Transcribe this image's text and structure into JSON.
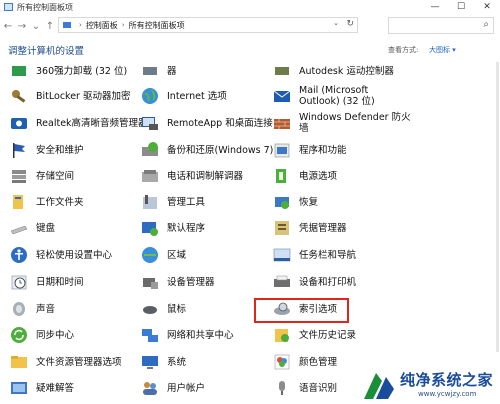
{
  "window": {
    "title": "所有控制面板项",
    "minimize": "—",
    "maximize": "☐",
    "close": "✕"
  },
  "nav": {
    "back": "←",
    "forward": "→",
    "dropdown": "⌄",
    "up": "↑"
  },
  "address": {
    "crumbs": [
      "控制面板",
      "所有控制面板项"
    ],
    "separator": "›",
    "dropdown": "⌄",
    "refresh": "↻"
  },
  "search": {
    "icon": "⌕"
  },
  "header": {
    "title": "调整计算机的设置",
    "view_by_label": "查看方式:",
    "view_by_value": "大图标 ▾"
  },
  "items": {
    "col0": [
      "360强力卸载 (32 位)",
      "BitLocker 驱动器加密",
      "Realtek高清晰音频管理器",
      "安全和维护",
      "存储空间",
      "工作文件夹",
      "键盘",
      "轻松使用设置中心",
      "日期和时间",
      "声音",
      "同步中心",
      "文件资源管理器选项",
      "疑难解答"
    ],
    "col1": [
      "器",
      "Internet 选项",
      "RemoteApp 和桌面连接",
      "备份和还原(Windows 7)",
      "电话和调制解调器",
      "管理工具",
      "默认程序",
      "区域",
      "设备管理器",
      "鼠标",
      "网络和共享中心",
      "系统",
      "用户帐户"
    ],
    "col2": [
      "Autodesk 运动控制器",
      "Mail (Microsoft\nOutlook) (32 位)",
      "Windows Defender 防火\n墙",
      "程序和功能",
      "电源选项",
      "恢复",
      "凭据管理器",
      "任务栏和导航",
      "设备和打印机",
      "索引选项",
      "文件历史记录",
      "颜色管理",
      "语音识别"
    ]
  },
  "watermark": {
    "brand": "纯净系统之家",
    "url": "www.ycwjzy.com"
  }
}
